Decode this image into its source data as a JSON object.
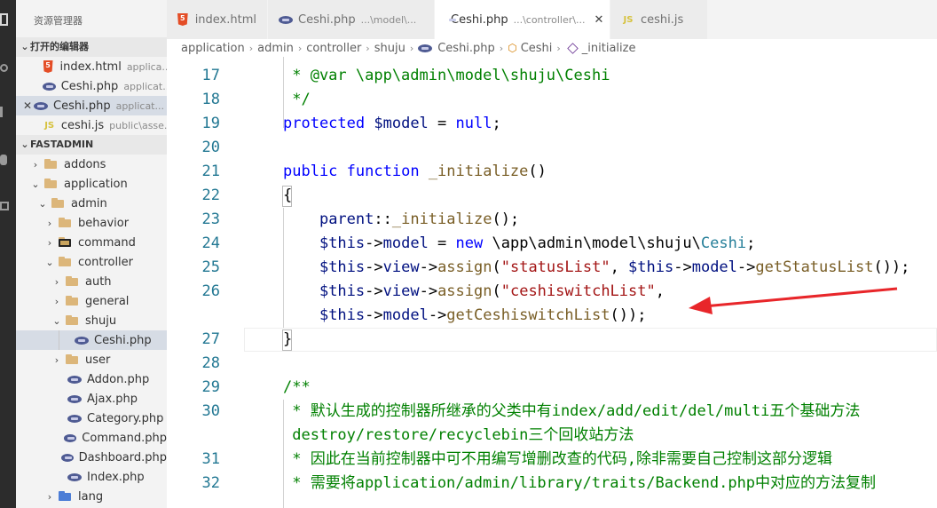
{
  "sidebar": {
    "title": "资源管理器",
    "open_editors_header": "打开的编辑器",
    "open_editors": [
      {
        "name": "index.html",
        "desc": "applica..."
      },
      {
        "name": "Ceshi.php",
        "desc": "applicat..."
      },
      {
        "name": "Ceshi.php",
        "desc": "applicat..."
      },
      {
        "name": "ceshi.js",
        "desc": "public\\asse..."
      }
    ],
    "project_header": "FASTADMIN",
    "tree": [
      "addons",
      "application",
      "admin",
      "behavior",
      "command",
      "controller",
      "auth",
      "general",
      "shuju",
      "Ceshi.php",
      "user",
      "Addon.php",
      "Ajax.php",
      "Category.php",
      "Command.php",
      "Dashboard.php",
      "Index.php",
      "lang"
    ]
  },
  "tabs": [
    {
      "name": "index.html",
      "desc": ""
    },
    {
      "name": "Ceshi.php",
      "desc": "...\\model\\..."
    },
    {
      "name": "Ceshi.php",
      "desc": "...\\controller\\..."
    },
    {
      "name": "ceshi.js",
      "desc": ""
    }
  ],
  "breadcrumb": [
    "application",
    "admin",
    "controller",
    "shuju",
    "Ceshi.php",
    "Ceshi",
    "_initialize"
  ],
  "editor": {
    "line_numbers": [
      "17",
      "18",
      "19",
      "20",
      "21",
      "22",
      "23",
      "24",
      "25",
      "26",
      "27",
      "28",
      "29",
      "30",
      "31",
      "32"
    ],
    "lines": [
      {
        "tokens": [
          [
            "cmt",
            " * @var \\app\\admin\\model\\shuju\\Ceshi"
          ]
        ]
      },
      {
        "tokens": [
          [
            "cmt",
            " */"
          ]
        ]
      },
      {
        "tokens": [
          [
            "kw",
            "protected"
          ],
          [
            "plain",
            " "
          ],
          [
            "var",
            "$model"
          ],
          [
            "plain",
            " = "
          ],
          [
            "kw",
            "null"
          ],
          [
            "plain",
            ";"
          ]
        ]
      },
      {
        "tokens": []
      },
      {
        "tokens": [
          [
            "kw",
            "public"
          ],
          [
            "plain",
            " "
          ],
          [
            "kw",
            "function"
          ],
          [
            "plain",
            " "
          ],
          [
            "fn",
            "_initialize"
          ],
          [
            "plain",
            "()"
          ]
        ]
      },
      {
        "tokens": [
          [
            "plain",
            "{"
          ]
        ]
      },
      {
        "tokens": [
          [
            "plain",
            "    "
          ],
          [
            "var",
            "parent"
          ],
          [
            "plain",
            "::"
          ],
          [
            "fn",
            "_initialize"
          ],
          [
            "plain",
            "();"
          ]
        ]
      },
      {
        "tokens": [
          [
            "plain",
            "    "
          ],
          [
            "var",
            "$this"
          ],
          [
            "plain",
            "->"
          ],
          [
            "var",
            "model"
          ],
          [
            "plain",
            " = "
          ],
          [
            "kw",
            "new"
          ],
          [
            "plain",
            " \\app\\admin\\model\\shuju\\"
          ],
          [
            "ns",
            "Ceshi"
          ],
          [
            "plain",
            ";"
          ]
        ]
      },
      {
        "tokens": [
          [
            "plain",
            "    "
          ],
          [
            "var",
            "$this"
          ],
          [
            "plain",
            "->"
          ],
          [
            "var",
            "view"
          ],
          [
            "plain",
            "->"
          ],
          [
            "fn",
            "assign"
          ],
          [
            "plain",
            "("
          ],
          [
            "str",
            "\"statusList\""
          ],
          [
            "plain",
            ", "
          ],
          [
            "var",
            "$this"
          ],
          [
            "plain",
            "->"
          ],
          [
            "var",
            "model"
          ],
          [
            "plain",
            "->"
          ],
          [
            "fn",
            "getStatusList"
          ],
          [
            "plain",
            "());"
          ]
        ]
      },
      {
        "tokens": [
          [
            "plain",
            "    "
          ],
          [
            "var",
            "$this"
          ],
          [
            "plain",
            "->"
          ],
          [
            "var",
            "view"
          ],
          [
            "plain",
            "->"
          ],
          [
            "fn",
            "assign"
          ],
          [
            "plain",
            "("
          ],
          [
            "str",
            "\"ceshiswitchList\""
          ],
          [
            "plain",
            ","
          ]
        ]
      },
      {
        "tokens": [
          [
            "plain",
            "    "
          ],
          [
            "var",
            "$this"
          ],
          [
            "plain",
            "->"
          ],
          [
            "var",
            "model"
          ],
          [
            "plain",
            "->"
          ],
          [
            "fn",
            "getCeshiswitchList"
          ],
          [
            "plain",
            "());"
          ]
        ]
      },
      {
        "tokens": [
          [
            "plain",
            "}"
          ]
        ]
      },
      {
        "tokens": []
      },
      {
        "tokens": [
          [
            "cmt",
            "/**"
          ]
        ]
      },
      {
        "tokens": [
          [
            "cmt",
            " * 默认生成的控制器所继承的父类中有index/add/edit/del/multi五个基础方法"
          ]
        ]
      },
      {
        "tokens": [
          [
            "cmt",
            " destroy/restore/recyclebin三个回收站方法"
          ]
        ]
      },
      {
        "tokens": [
          [
            "cmt",
            " * 因此在当前控制器中可不用编写增删改查的代码,除非需要自己控制这部分逻辑"
          ]
        ]
      },
      {
        "tokens": [
          [
            "cmt",
            " * 需要将application/admin/library/traits/Backend.php中对应的方法复制"
          ]
        ]
      }
    ]
  },
  "colors": {
    "activity_bar": "#2c2c2c",
    "sidebar": "#f3f3f3",
    "keyword": "#0000ff",
    "variable": "#001080",
    "function": "#795e26",
    "string": "#a31515",
    "comment": "#008000",
    "line_number": "#237893",
    "arrow": "#e8262a"
  }
}
